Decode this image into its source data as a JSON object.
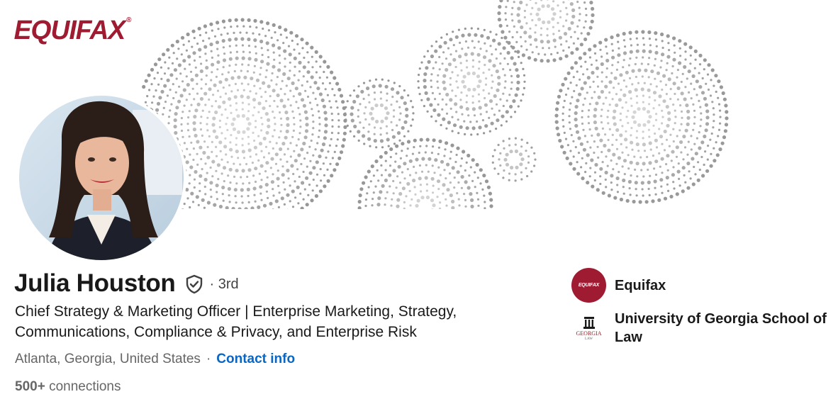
{
  "banner": {
    "brand_logo_text": "EQUIFAX",
    "brand_logo_mark": "®",
    "brand_color": "#9e1b32"
  },
  "profile": {
    "avatar_icon": "profile-photo",
    "name": "Julia Houston",
    "verified_icon": "shield-check-icon",
    "degree": "· 3rd",
    "headline": "Chief Strategy & Marketing Officer | Enterprise Marketing, Strategy, Communications, Compliance & Privacy, and Enterprise Risk",
    "location": "Atlanta, Georgia, United States",
    "separator": "·",
    "contact_info_label": "Contact info",
    "connections_count": "500+",
    "connections_label": "connections"
  },
  "organizations": [
    {
      "name": "Equifax",
      "logo_text": "EQUIFAX",
      "logo_bg": "#9e1b32"
    },
    {
      "name": "University of Georgia School of Law",
      "logo_text": "GEORGIA",
      "logo_subtext": "LAW"
    }
  ],
  "colors": {
    "link": "#0a66c2",
    "text_primary": "#1a1a1a",
    "text_secondary": "#666666"
  }
}
